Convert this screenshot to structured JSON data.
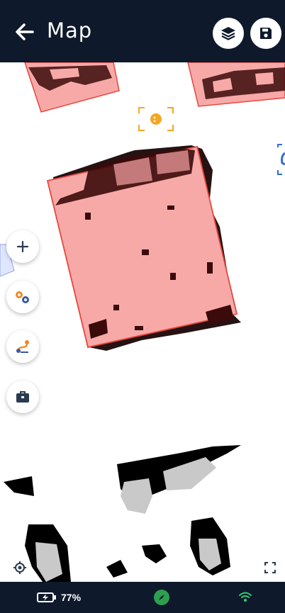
{
  "header": {
    "title": "Map",
    "back_icon": "arrow-left-icon",
    "layers_icon": "layers-icon",
    "save_icon": "floppy-disk-icon"
  },
  "map": {
    "zone_fill_color": "#f7a9a8",
    "zone_stroke_color": "#e8463c",
    "obstacle_color": "#3b0a0a",
    "robot_marker_color": "#f5a623",
    "dock_marker_color": "#2f6fd0"
  },
  "fab_buttons": [
    {
      "name": "zoom-in-button",
      "icon": "plus-icon"
    },
    {
      "name": "settings-button",
      "icon": "gears-icon"
    },
    {
      "name": "route-button",
      "icon": "route-icon"
    },
    {
      "name": "toolbox-button",
      "icon": "toolbox-icon"
    }
  ],
  "map_controls": {
    "locate_icon": "crosshair-icon",
    "fullscreen_icon": "fullscreen-icon"
  },
  "status": {
    "battery_percent": "77%",
    "battery_icon": "battery-charging-icon",
    "compass_icon": "compass-icon",
    "wifi_icon": "wifi-icon",
    "accent_color": "#2e9e4f"
  }
}
